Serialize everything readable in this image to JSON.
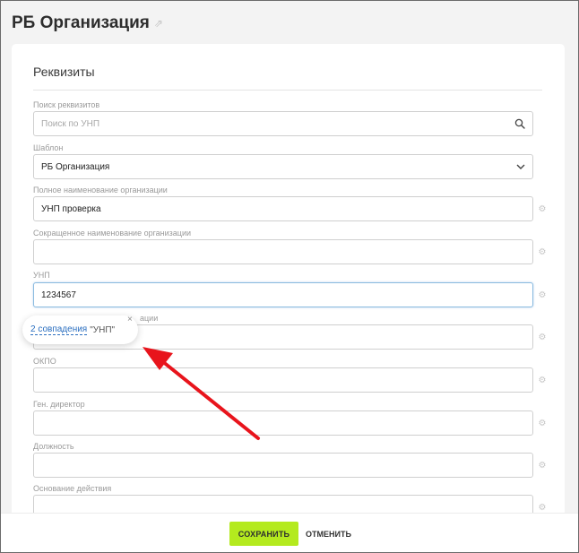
{
  "page": {
    "title": "РБ Организация",
    "title_icon": "link-icon"
  },
  "card": {
    "title": "Реквизиты"
  },
  "fields": {
    "search": {
      "label": "Поиск реквизитов",
      "placeholder": "Поиск по УНП",
      "icon": "search-icon"
    },
    "template": {
      "label": "Шаблон",
      "value": "РБ Организация",
      "icon": "chevron-down-icon"
    },
    "full_name": {
      "label": "Полное наименование организации",
      "value": "УНП проверка"
    },
    "short_name": {
      "label": "Сокращенное наименование организации",
      "value": ""
    },
    "unp": {
      "label": "УНП",
      "value": "1234567"
    },
    "address": {
      "label_visible_fragment": "ации",
      "value": ""
    },
    "okpo": {
      "label": "ОКПО",
      "value": ""
    },
    "director": {
      "label": "Ген. директор",
      "value": ""
    },
    "position": {
      "label": "Должность",
      "value": ""
    },
    "basis": {
      "label": "Основание действия",
      "value": ""
    }
  },
  "tooltip": {
    "matches_text": "2 совпадения",
    "field_text": "\"УНП\"",
    "close_symbol": "×"
  },
  "annotation": {
    "arrow_color": "#e8141c"
  },
  "footer": {
    "save_label": "СОХРАНИТЬ",
    "cancel_label": "ОТМЕНИТЬ"
  },
  "colors": {
    "accent_green": "#b4ea1e",
    "link_blue": "#2b6fc0",
    "focus_border": "#8bbbe0"
  }
}
